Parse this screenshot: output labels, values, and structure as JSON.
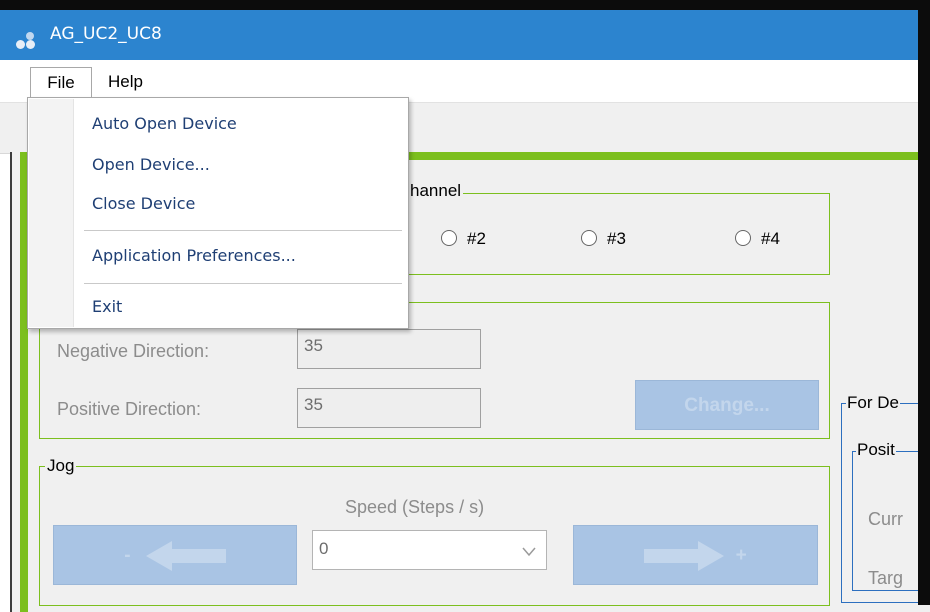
{
  "window": {
    "title": "AG_UC2_UC8"
  },
  "menubar": {
    "file": "File",
    "help": "Help"
  },
  "file_menu": {
    "items": [
      "Auto Open Device",
      "Open Device...",
      "Close Device",
      "Application Preferences...",
      "Exit"
    ]
  },
  "channel": {
    "label_partial": "hannel",
    "options": [
      "#2",
      "#3",
      "#4"
    ]
  },
  "step_amplitude": {
    "negative_label": "Negative Direction:",
    "negative_value": "35",
    "positive_label": "Positive Direction:",
    "positive_value": "35",
    "change_button": "Change..."
  },
  "jog": {
    "label": "Jog",
    "speed_label": "Speed (Steps / s)",
    "speed_value": "0",
    "minus_label": "-",
    "plus_label": "+"
  },
  "side_panel": {
    "group_label": "For De",
    "position_label": "Posit",
    "current_label": "Curr",
    "target_label": "Targ"
  },
  "colors": {
    "titlebar": "#2c84cf",
    "accent_green": "#7cbf1e",
    "disabled_button": "#a9c4e4",
    "menu_text": "#1f3f74"
  }
}
